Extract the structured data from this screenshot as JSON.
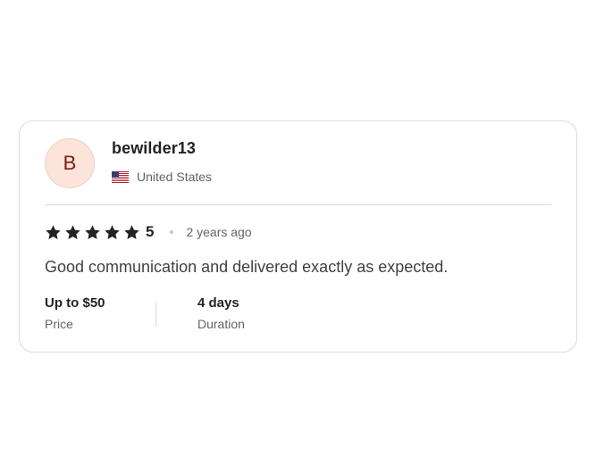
{
  "review": {
    "avatar_initial": "B",
    "username": "bewilder13",
    "country": "United States",
    "country_flag_icon": "us-flag-icon",
    "rating": 5,
    "rating_label": "5",
    "time_ago": "2 years ago",
    "comment": "Good communication and delivered exactly as expected.",
    "price": {
      "value": "Up to $50",
      "label": "Price"
    },
    "duration": {
      "value": "4 days",
      "label": "Duration"
    }
  },
  "colors": {
    "avatar_bg": "#fde4da",
    "avatar_text": "#7a1f0f",
    "star": "#222325",
    "border": "#dadbdd",
    "muted_text": "#62646a"
  }
}
